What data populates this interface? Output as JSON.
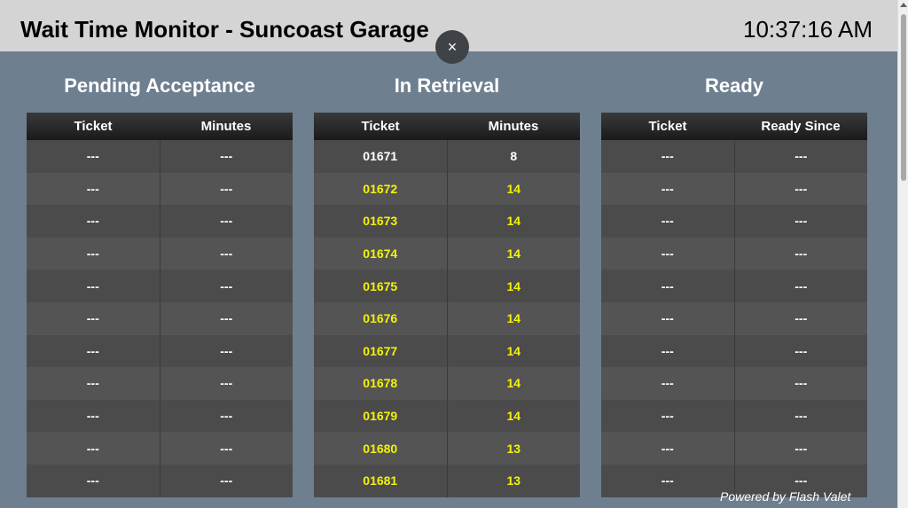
{
  "header": {
    "title": "Wait Time Monitor - Suncoast Garage",
    "clock": "10:37:16 AM"
  },
  "close_symbol": "×",
  "colors": {
    "warning": "#f2f20a",
    "normal": "#ffffff",
    "background": "#6e7f90",
    "header": "#d4d4d4"
  },
  "panels": [
    {
      "title": "Pending Acceptance",
      "columns": [
        "Ticket",
        "Minutes"
      ],
      "rows": [
        [
          "---",
          "---"
        ],
        [
          "---",
          "---"
        ],
        [
          "---",
          "---"
        ],
        [
          "---",
          "---"
        ],
        [
          "---",
          "---"
        ],
        [
          "---",
          "---"
        ],
        [
          "---",
          "---"
        ],
        [
          "---",
          "---"
        ],
        [
          "---",
          "---"
        ],
        [
          "---",
          "---"
        ],
        [
          "---",
          "---"
        ]
      ]
    },
    {
      "title": "In Retrieval",
      "columns": [
        "Ticket",
        "Minutes"
      ],
      "rows": [
        [
          "01671",
          "8"
        ],
        [
          "01672",
          "14"
        ],
        [
          "01673",
          "14"
        ],
        [
          "01674",
          "14"
        ],
        [
          "01675",
          "14"
        ],
        [
          "01676",
          "14"
        ],
        [
          "01677",
          "14"
        ],
        [
          "01678",
          "14"
        ],
        [
          "01679",
          "14"
        ],
        [
          "01680",
          "13"
        ],
        [
          "01681",
          "13"
        ]
      ],
      "highlight_rows": [
        1,
        2,
        3,
        4,
        5,
        6,
        7,
        8,
        9,
        10
      ]
    },
    {
      "title": "Ready",
      "columns": [
        "Ticket",
        "Ready Since"
      ],
      "rows": [
        [
          "---",
          "---"
        ],
        [
          "---",
          "---"
        ],
        [
          "---",
          "---"
        ],
        [
          "---",
          "---"
        ],
        [
          "---",
          "---"
        ],
        [
          "---",
          "---"
        ],
        [
          "---",
          "---"
        ],
        [
          "---",
          "---"
        ],
        [
          "---",
          "---"
        ],
        [
          "---",
          "---"
        ],
        [
          "---",
          "---"
        ]
      ]
    }
  ],
  "footer": {
    "powered_by": "Powered by Flash Valet"
  }
}
